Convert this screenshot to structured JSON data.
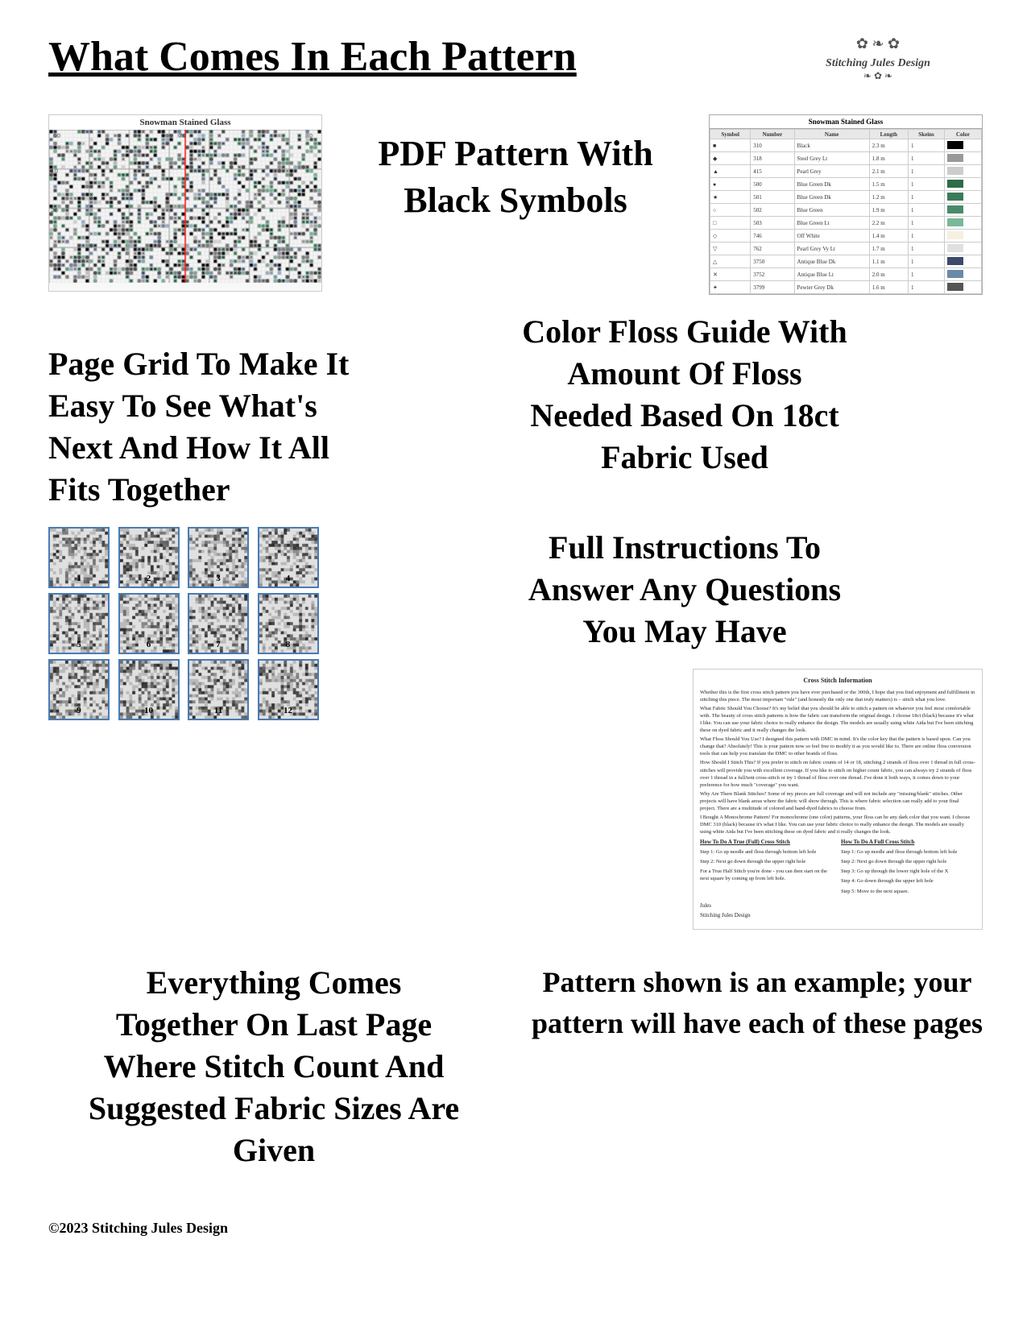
{
  "header": {
    "title": "What Comes In Each Pattern",
    "brand_name": "Stitching Jules Design",
    "brand_ornament": "❧ ✿ ❧"
  },
  "section1": {
    "chart_title": "Snowman Stained Glass",
    "pdf_text_line1": "PDF Pattern With",
    "pdf_text_line2": "Black Symbols"
  },
  "section2": {
    "page_grid_text": "Page Grid To Make It Easy To See What's Next And How It All Fits Together",
    "color_floss_text_line1": "Color Floss Guide With",
    "color_floss_text_line2": "Amount Of Floss",
    "color_floss_text_line3": "Needed Based On 18ct",
    "color_floss_text_line4": "Fabric Used",
    "floss_table": {
      "title": "Snowman Stained Glass",
      "headers": [
        "Symbol",
        "Number",
        "Name",
        "Length",
        "Skeins",
        "Color"
      ],
      "rows": [
        [
          "■",
          "310",
          "Black",
          "2.3 m",
          "1",
          "#000000"
        ],
        [
          "◆",
          "318",
          "Steel Grey Lt",
          "1.8 m",
          "1",
          "#999999"
        ],
        [
          "▲",
          "415",
          "Pearl Grey",
          "2.1 m",
          "1",
          "#cccccc"
        ],
        [
          "●",
          "500",
          "Blue Green Dk",
          "1.5 m",
          "1",
          "#2d6b4a"
        ],
        [
          "★",
          "501",
          "Blue Green Dk",
          "1.2 m",
          "1",
          "#3a7a5a"
        ],
        [
          "○",
          "502",
          "Blue Green",
          "1.9 m",
          "1",
          "#4a8a6a"
        ],
        [
          "□",
          "503",
          "Blue Green Lt",
          "2.2 m",
          "1",
          "#7ab89a"
        ],
        [
          "◇",
          "746",
          "Off White",
          "1.4 m",
          "1",
          "#f5f0e0"
        ],
        [
          "▽",
          "762",
          "Pearl Grey Vy Lt",
          "1.7 m",
          "1",
          "#e0e0e0"
        ],
        [
          "△",
          "3750",
          "Antique Blue Dk",
          "1.1 m",
          "1",
          "#3a4a6a"
        ],
        [
          "✕",
          "3752",
          "Antique Blue Lt",
          "2.0 m",
          "1",
          "#6a8aaa"
        ],
        [
          "✦",
          "3799",
          "Pewter Grey Dk",
          "1.6 m",
          "1",
          "#555555"
        ]
      ]
    }
  },
  "section3": {
    "pages": [
      {
        "num": "1"
      },
      {
        "num": "2"
      },
      {
        "num": "3"
      },
      {
        "num": "4"
      },
      {
        "num": "5"
      },
      {
        "num": "6"
      },
      {
        "num": "7"
      },
      {
        "num": "8"
      },
      {
        "num": "9"
      },
      {
        "num": "10"
      },
      {
        "num": "11"
      },
      {
        "num": "12"
      }
    ],
    "full_instructions_line1": "Full Instructions To",
    "full_instructions_line2": "Answer Any Questions",
    "full_instructions_line3": "You May Have",
    "cross_stitch_info_title": "Cross Stitch Information",
    "cross_stitch_info_body": "Whether this is the first cross stitch pattern you have ever purchased or the 300th, I hope that you find enjoyment and fulfillment in stitching this piece. The most important \"rule\" (and honestly the only one that truly matters) is – stitch what you love.\n\nWhat Fabric Should You Choose? It's my belief that you should be able to stitch a pattern on whatever you feel most comfortable with. The beauty of cross stitch patterns is how the fabric can transform the original design. I choose 18ct (black) because it's what I like. You can use your fabric choice to really enhance the design. The models are usually using white Aida but I've been stitching these on dyed fabric and it really changes the look.\n\nWhat Floss Should You Use? I designed this pattern with DMC in mind. It's the color key that the pattern is based upon. Can you change that? Absolutely! This is your pattern now so feel free to modify it as you would like to. There are online floss conversion tools that can help you translate the DMC to other brands of floss.\n\nHow Should I Stitch This? If you prefer to stitch on fabric counts of 14 or 18, stitching 2 strands of floss over 1 thread in full cross-stitches will provide you with excellent coverage. If you like to stitch on higher count fabric, you can always try 2 strands of floss over 1 thread in a full/tent cross-stitch or try 1 thread of floss over one thread. I've done it both ways, it comes down to your preference for how much \"coverage\" you want.\n\nWhy Are There Blank Stitches? Some of my pieces are full coverage and will not include any \"missing/blank\" stitches. Other projects will have blank areas where the fabric will show through. This is where fabric selection can really add to your final project. There are a multitude of colored and hand-dyed fabrics to choose from.\n\nI Bought A Monochrome Pattern! For monochrome (one color) patterns, your floss can be any dark color that you want. I choose DMC 310 (black) because it's what I like. You can use your fabric choice to really enhance the design. The models are usually using white Aida but I've been stitching these on dyed fabric and it really changes the look.",
    "how_to_ev_title": "How To Do A True (Full) Cross Stitch",
    "how_to_ev_steps": "Step 1: Go up needle and floss through bottom left hole\nStep 2: Next go down through the upper right hole\nFor a True Half Stitch you're done - you can then start on the next square by coming up from left hole.",
    "how_to_fc_title": "How To Do A Full Cross Stitch",
    "how_to_fc_steps": "Step 1: Go up needle and floss through bottom left hole\nStep 2: Next go down through the upper right hole\nStep 3: Go up through the lower right hole of the X\nStep 4: Go down through the upper left hole\nStep 5: Move to the next square.",
    "signature": "Jules\nStitching Jules Design"
  },
  "section4": {
    "everything_together_line1": "Everything Comes",
    "everything_together_line2": "Together On Last Page",
    "everything_together_line3": "Where Stitch Count And",
    "everything_together_line4": "Suggested Fabric Sizes Are",
    "everything_together_line5": "Given",
    "example_note": "Pattern shown is an example; your pattern will have each of these pages"
  },
  "footer": {
    "copyright": "©2023 Stitching Jules Design"
  }
}
